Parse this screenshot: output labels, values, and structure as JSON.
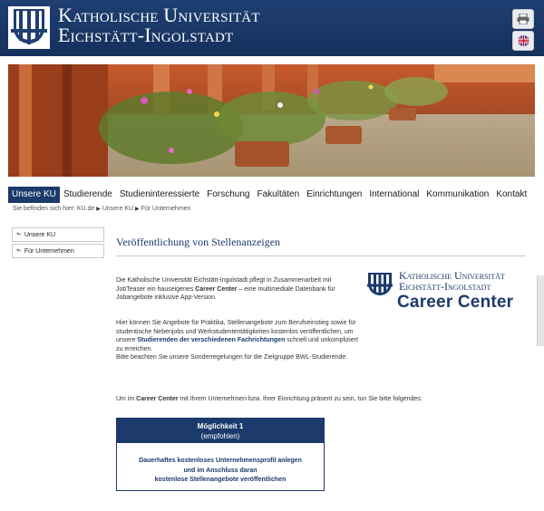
{
  "header": {
    "university_line1": "Katholische Universität",
    "university_line2": "Eichstätt-Ingolstadt",
    "print_icon": "printer-icon",
    "language_icon": "uk-flag-icon"
  },
  "nav": {
    "items": [
      {
        "label": "Unsere KU",
        "active": true
      },
      {
        "label": "Studierende"
      },
      {
        "label": "Studieninteressierte"
      },
      {
        "label": "Forschung"
      },
      {
        "label": "Fakultäten"
      },
      {
        "label": "Einrichtungen"
      },
      {
        "label": "International"
      },
      {
        "label": "Kommunikation"
      },
      {
        "label": "Kontakt"
      }
    ]
  },
  "breadcrumb": {
    "prefix": "Sie befinden sich hier: KU.de",
    "items": [
      "Unsere KU",
      "Für Unternehmen"
    ]
  },
  "sidebar": {
    "items": [
      "Unsere KU",
      "Für Unternehmen"
    ]
  },
  "main": {
    "title": "Veröffentlichung von Stellenanzeigen",
    "intro_a": "Die Katholische Universität Eichstätt-Ingolstadt pflegt in Zusammenarbeit mit JobTeaser ein hauseigenes ",
    "intro_strong": "Career Center",
    "intro_b": " – eine multimediale Datenbank für Jobangebote inklusive App-Version.",
    "para2_a": "Hier können Sie Angebote für Praktika, Stellenangebote zum Berufseinstieg sowie für studentische Nebenjobs und Werkstudententätigkeiten kostenlos veröffentlichen, um unsere ",
    "para2_link": "Studierenden der verschiedenen Fachrichtungen",
    "para2_b": " schnell und unkompliziert zu erreichen.",
    "para2_c": "Bitte beachten Sie unsere Sonderregelungen für die Zielgruppe BWL-Studierende.",
    "para3_a": "Um im ",
    "para3_strong": "Career Center",
    "para3_b": " mit Ihrem Unternehmen bzw. Ihrer Einrichtung präsent zu sein, tun Sie bitte folgendes:",
    "career_logo": {
      "line1": "Katholische Universität",
      "line2": "Eichstätt-Ingolstadt",
      "line3": "Career Center"
    },
    "option": {
      "title": "Möglichkeit 1",
      "subtitle": "(empfohlen)",
      "line1": "Dauerhaftes kostenloses Unternehmensprofil anlegen",
      "line2": "und im Anschluss daran",
      "line3": "kostenlose Stellenangebote veröffentlichen"
    }
  },
  "colors": {
    "brand_blue": "#1c3a6b",
    "header_bg": "#1a3766"
  }
}
